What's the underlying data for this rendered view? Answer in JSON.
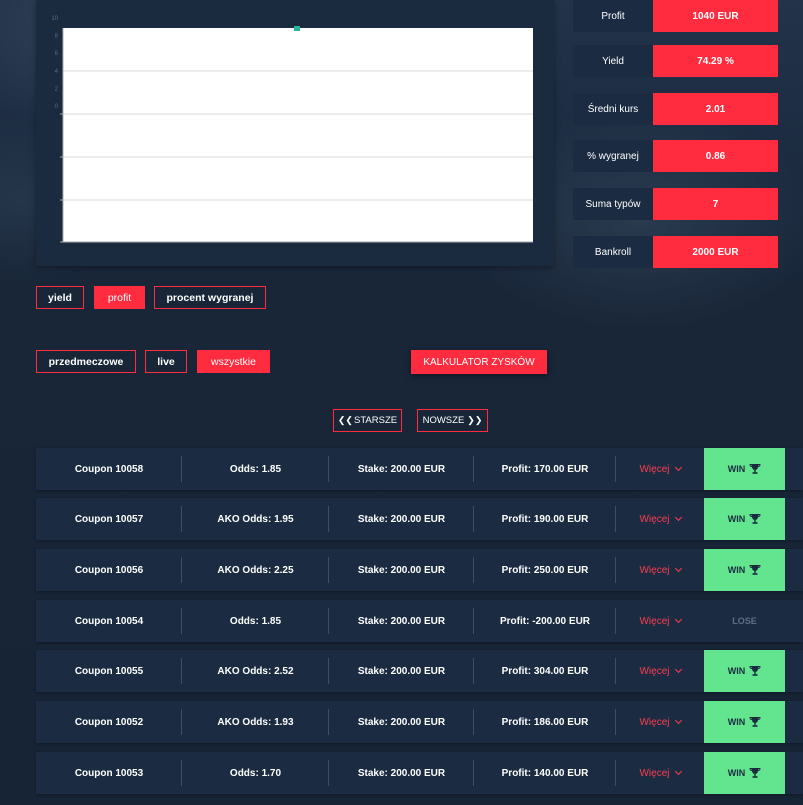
{
  "chart": {
    "y_ticks": [
      "10",
      "8",
      "6",
      "4",
      "2",
      "0"
    ]
  },
  "stats": [
    {
      "label": "Profit",
      "value": "1040 EUR"
    },
    {
      "label": "Yield",
      "value": "74.29 %"
    },
    {
      "label": "Średni kurs",
      "value": "2.01"
    },
    {
      "label": "% wygranej",
      "value": "0.86"
    },
    {
      "label": "Suma typów",
      "value": "7"
    },
    {
      "label": "Bankroll",
      "value": "2000 EUR"
    }
  ],
  "metric_tabs": {
    "yield": "yield",
    "profit": "profit",
    "percent": "procent wygranej"
  },
  "filter_tabs": {
    "prematch": "przedmeczowe",
    "live": "live",
    "all": "wszystkie"
  },
  "calculator_label": "KALKULATOR ZYSKÓW",
  "pagination": {
    "older": "STARSZE",
    "newer": "NOWSZE"
  },
  "coupons": [
    {
      "coupon": "Coupon 10058",
      "odds": "Odds: 1.85",
      "stake": "Stake: 200.00 EUR",
      "profit": "Profit: 170.00 EUR",
      "more": "Więcej",
      "result": "WIN"
    },
    {
      "coupon": "Coupon 10057",
      "odds": "AKO Odds: 1.95",
      "stake": "Stake: 200.00 EUR",
      "profit": "Profit: 190.00 EUR",
      "more": "Więcej",
      "result": "WIN"
    },
    {
      "coupon": "Coupon 10056",
      "odds": "AKO Odds: 2.25",
      "stake": "Stake: 200.00 EUR",
      "profit": "Profit: 250.00 EUR",
      "more": "Więcej",
      "result": "WIN"
    },
    {
      "coupon": "Coupon 10054",
      "odds": "Odds: 1.85",
      "stake": "Stake: 200.00 EUR",
      "profit": "Profit: -200.00 EUR",
      "more": "Więcej",
      "result": "LOSE"
    },
    {
      "coupon": "Coupon 10055",
      "odds": "AKO Odds: 2.52",
      "stake": "Stake: 200.00 EUR",
      "profit": "Profit: 304.00 EUR",
      "more": "Więcej",
      "result": "WIN"
    },
    {
      "coupon": "Coupon 10052",
      "odds": "AKO Odds: 1.93",
      "stake": "Stake: 200.00 EUR",
      "profit": "Profit: 186.00 EUR",
      "more": "Więcej",
      "result": "WIN"
    },
    {
      "coupon": "Coupon 10053",
      "odds": "Odds: 1.70",
      "stake": "Stake: 200.00 EUR",
      "profit": "Profit: 140.00 EUR",
      "more": "Więcej",
      "result": "WIN"
    }
  ],
  "colors": {
    "accent": "#ff2b3e",
    "win": "#63e48e",
    "panel": "#1b2c42",
    "marker": "#2bb3a0"
  },
  "icons": {
    "win": "trophy-icon",
    "more": "chevron-down-icon",
    "older": "double-chevron-left-icon",
    "newer": "double-chevron-right-icon"
  }
}
